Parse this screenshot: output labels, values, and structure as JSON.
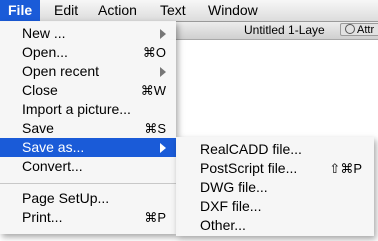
{
  "menubar": {
    "items": [
      {
        "label": "File"
      },
      {
        "label": "Edit"
      },
      {
        "label": "Action"
      },
      {
        "label": "Text"
      },
      {
        "label": "Window"
      }
    ]
  },
  "window": {
    "title": "Untitled 1-Laye",
    "attr_button": "Attr"
  },
  "file_menu": {
    "items": [
      {
        "label": "New ...",
        "shortcut": ""
      },
      {
        "label": "Open...",
        "shortcut": "⌘O"
      },
      {
        "label": "Open recent",
        "shortcut": ""
      },
      {
        "label": "Close",
        "shortcut": "⌘W"
      },
      {
        "label": "Import a picture...",
        "shortcut": ""
      },
      {
        "label": "Save",
        "shortcut": "⌘S"
      },
      {
        "label": "Save as...",
        "shortcut": ""
      },
      {
        "label": "Convert...",
        "shortcut": ""
      },
      {
        "label": "Page SetUp...",
        "shortcut": ""
      },
      {
        "label": "Print...",
        "shortcut": "⌘P"
      }
    ]
  },
  "save_as_submenu": {
    "items": [
      {
        "label": "RealCADD file...",
        "shortcut": ""
      },
      {
        "label": "PostScript file...",
        "shortcut": "⇧⌘P"
      },
      {
        "label": "DWG file...",
        "shortcut": ""
      },
      {
        "label": "DXF file...",
        "shortcut": ""
      },
      {
        "label": "Other...",
        "shortcut": ""
      }
    ]
  },
  "colors": {
    "highlight": "#1a5bd8",
    "menu_background": "#f6f6f6"
  }
}
